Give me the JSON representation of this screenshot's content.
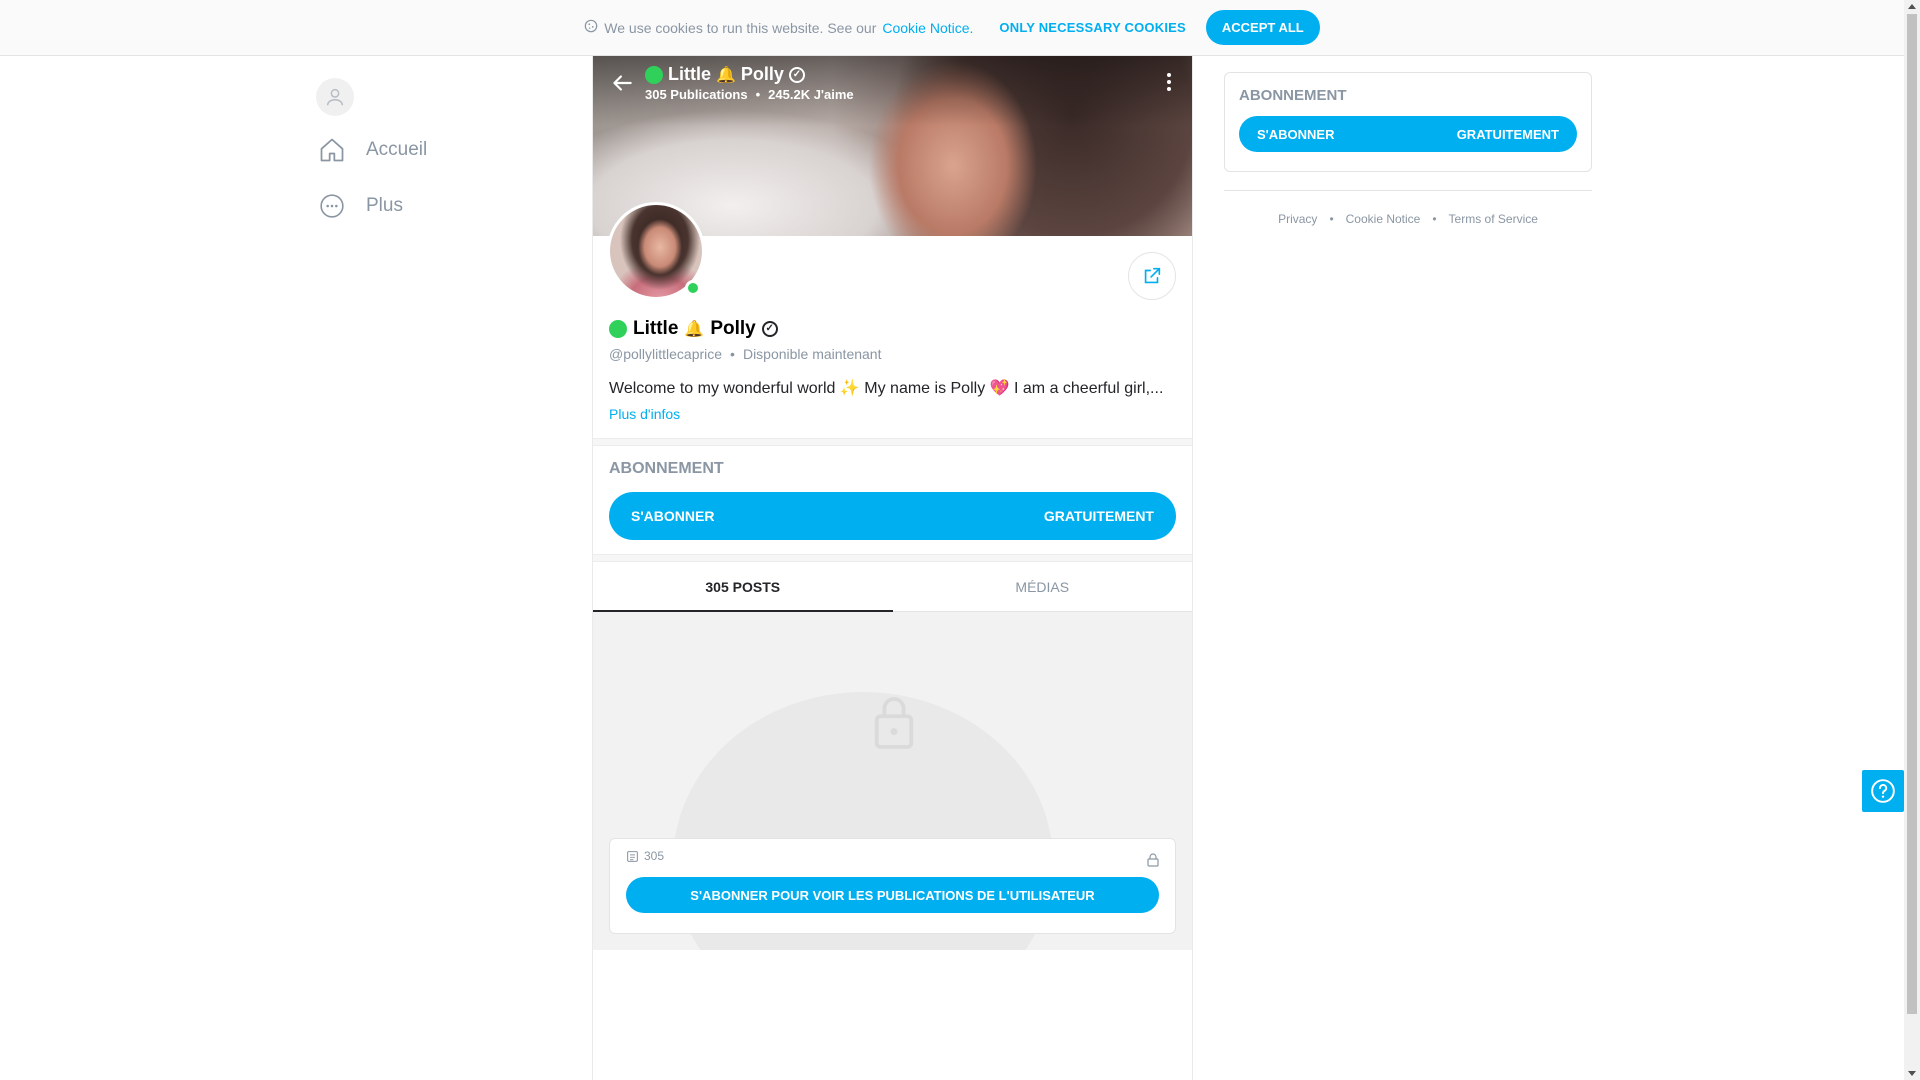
{
  "cookie_bar": {
    "text": "We use cookies to run this website. See our",
    "link": "Cookie Notice.",
    "necessary_label": "ONLY NECESSARY COOKIES",
    "accept_label": "ACCEPT ALL"
  },
  "nav": {
    "items": [
      {
        "label": "Accueil",
        "icon": "home-icon"
      },
      {
        "label": "Plus",
        "icon": "more-icon"
      }
    ]
  },
  "cover": {
    "name_first": "Little",
    "name_second": "Polly",
    "publications": "305 Publications",
    "likes": "245.2K J'aime"
  },
  "profile": {
    "name_first": "Little",
    "name_second": "Polly",
    "username": "@pollylittlecaprice",
    "status": "Disponible maintenant",
    "bio": "Welcome to my wonderful world ✨ My name is Polly 💖 I am a cheerful girl,...",
    "more_info": "Plus d'infos"
  },
  "subscription": {
    "title": "ABONNEMENT",
    "subscribe_label": "S'ABONNER",
    "price_label": "GRATUITEMENT"
  },
  "tabs": [
    {
      "label": "305 POSTS",
      "active": true
    },
    {
      "label": "MÉDIAS",
      "active": false
    }
  ],
  "locked": {
    "count": "305",
    "button_label": "S'ABONNER POUR VOIR LES PUBLICATIONS DE L'UTILISATEUR"
  },
  "footer": {
    "links": [
      "Privacy",
      "Cookie Notice",
      "Terms of Service"
    ]
  },
  "colors": {
    "accent": "#00aff0",
    "online": "#2fd15a",
    "muted": "#8a96a3"
  }
}
